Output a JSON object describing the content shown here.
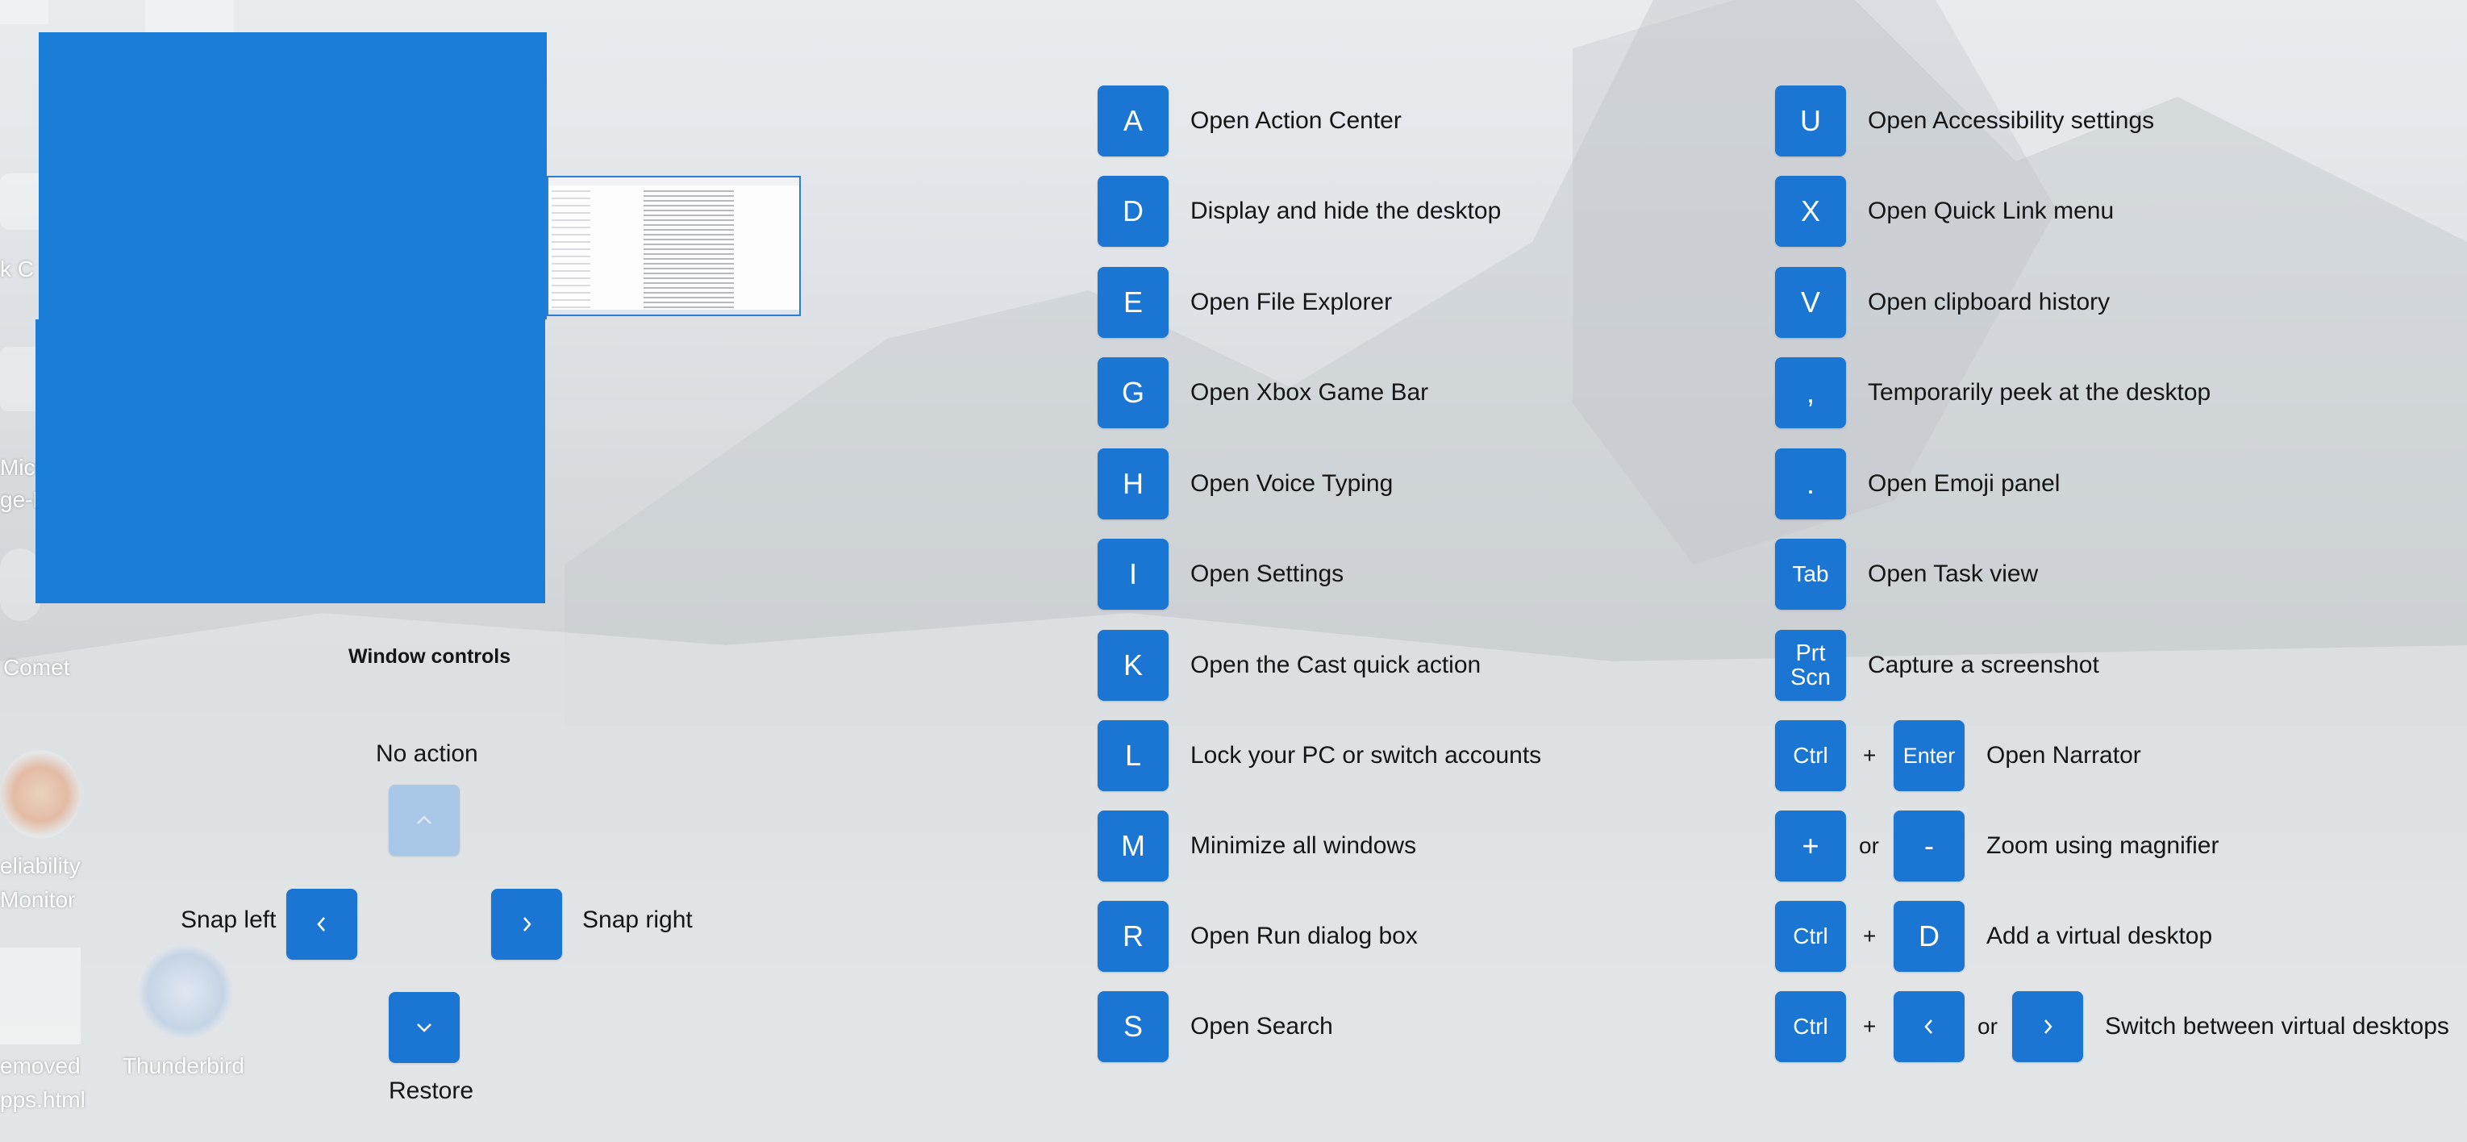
{
  "desktop_icons": {
    "comet": "Comet",
    "reliability_line1": "eliability",
    "reliability_line2": "Monitor",
    "removed_line1": "emoved",
    "removed_line2": "pps.html",
    "thunderbird": "Thunderbird",
    "micro_line1": "Micr",
    "micro_line2": "ge-D",
    "k_label": "k C"
  },
  "window_controls": {
    "title": "Window controls",
    "no_action": "No action",
    "snap_left": "Snap left",
    "snap_right": "Snap right",
    "restore": "Restore"
  },
  "shortcuts_left": [
    {
      "key": "A",
      "desc": "Open Action Center"
    },
    {
      "key": "D",
      "desc": "Display and hide the desktop"
    },
    {
      "key": "E",
      "desc": "Open File Explorer"
    },
    {
      "key": "G",
      "desc": "Open Xbox Game Bar"
    },
    {
      "key": "H",
      "desc": "Open Voice Typing"
    },
    {
      "key": "I",
      "desc": "Open Settings"
    },
    {
      "key": "K",
      "desc": "Open the Cast quick action"
    },
    {
      "key": "L",
      "desc": "Lock your PC or switch accounts"
    },
    {
      "key": "M",
      "desc": "Minimize all windows"
    },
    {
      "key": "R",
      "desc": "Open Run dialog box"
    },
    {
      "key": "S",
      "desc": "Open Search"
    }
  ],
  "shortcuts_right": [
    {
      "key": "U",
      "desc": "Open Accessibility settings"
    },
    {
      "key": "X",
      "desc": "Open Quick Link menu"
    },
    {
      "key": "V",
      "desc": "Open clipboard history"
    },
    {
      "key": ",",
      "desc": "Temporarily peek at the desktop"
    },
    {
      "key": ".",
      "desc": "Open Emoji panel"
    },
    {
      "key": "Tab",
      "desc": "Open Task view"
    },
    {
      "key_line1": "Prt",
      "key_line2": "Scn",
      "desc": "Capture a screenshot"
    }
  ],
  "combos": {
    "narrator": {
      "k1": "Ctrl",
      "sep": "+",
      "k2": "Enter",
      "desc": "Open Narrator"
    },
    "magnifier": {
      "k1": "+",
      "sep": "or",
      "k2": "-",
      "desc": "Zoom using magnifier"
    },
    "virtual": {
      "k1": "Ctrl",
      "sep": "+",
      "k2": "D",
      "desc": "Add a virtual desktop"
    },
    "switch": {
      "k1": "Ctrl",
      "sep1": "+",
      "sep2": "or",
      "desc": "Switch between virtual desktops"
    }
  },
  "icons": {
    "up": "chevron-up-icon",
    "left": "chevron-left-icon",
    "right": "chevron-right-icon",
    "down": "chevron-down-icon"
  },
  "colors": {
    "key_bg": "#1a76d2",
    "text": "#151515"
  }
}
